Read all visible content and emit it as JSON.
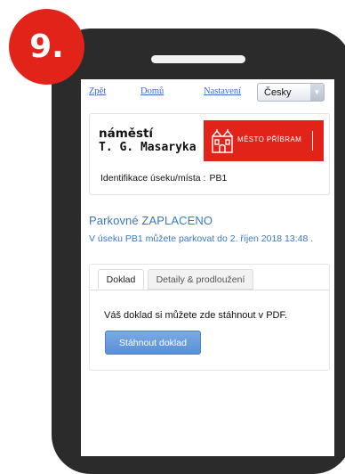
{
  "step_badge": "9.",
  "nav": {
    "back": "Zpět",
    "home": "Domů",
    "settings": "Nastavení",
    "language": "Česky"
  },
  "location": {
    "name_line1": "náměstí",
    "name_line2": "T. G. Masaryka",
    "logo_text": "MĚSTO PŘÍBRAM",
    "id_label": "Identifikace úseku/místa :",
    "id_value": "PB1"
  },
  "status": {
    "title": "Parkovné ZAPLACENO",
    "detail": "V úseku PB1 můžete parkovat do 2. říjen 2018 13:48 ."
  },
  "tabs": [
    {
      "label": "Doklad",
      "active": true
    },
    {
      "label": "Detaily & prodloužení",
      "active": false
    }
  ],
  "receipt": {
    "info": "Váš doklad si můžete zde stáhnout v PDF.",
    "download_label": "Stáhnout doklad"
  },
  "colors": {
    "badge": "#e2231a",
    "logo_bg": "#e2231a",
    "link": "#3a6ad4",
    "status": "#3a78c4",
    "button": "#5b8fd6"
  }
}
